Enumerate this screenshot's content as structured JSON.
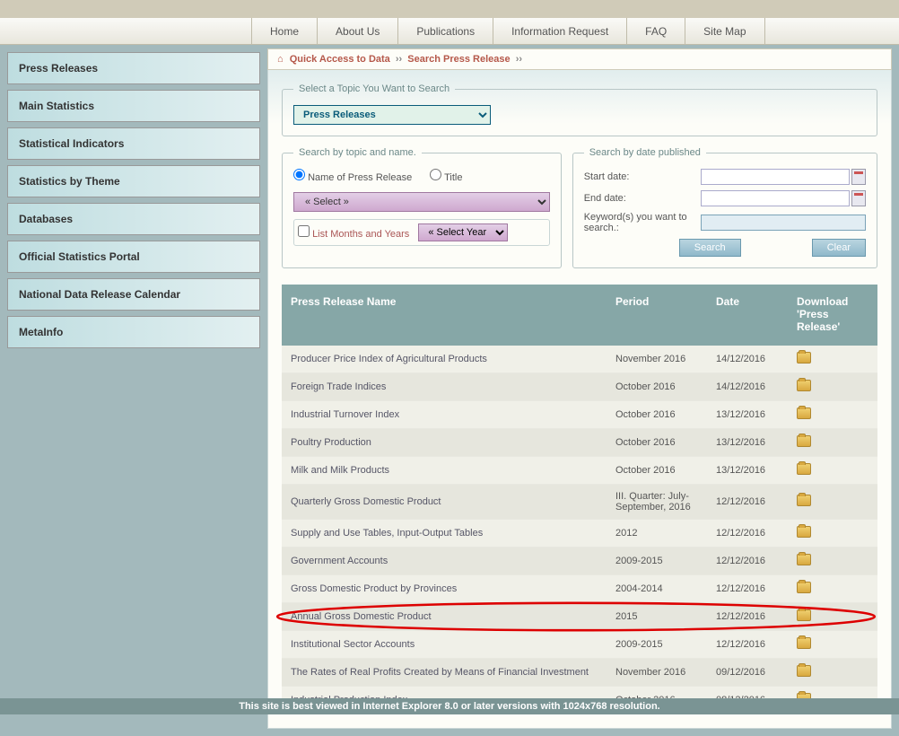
{
  "nav": {
    "items": [
      "Home",
      "About Us",
      "Publications",
      "Information Request",
      "FAQ",
      "Site Map"
    ]
  },
  "sidebar": {
    "items": [
      "Press Releases",
      "Main Statistics",
      "Statistical Indicators",
      "Statistics by Theme",
      "Databases",
      "Official Statistics Portal",
      "National Data Release Calendar",
      "MetaInfo"
    ]
  },
  "breadcrumb": {
    "item1": "Quick Access to Data",
    "item2": "Search Press Release",
    "sep": "››"
  },
  "topic_legend": "Select a Topic You Want to Search",
  "topic_value": "Press Releases",
  "search_by": {
    "legend": "Search by topic and name.",
    "opt_name": "Name of Press Release",
    "opt_title": "Title",
    "select_label": "« Select »",
    "list_months": "List Months and Years",
    "select_year": "« Select Year"
  },
  "search_date": {
    "legend": "Search by date published",
    "start": "Start date:",
    "end": "End date:",
    "keyword": "Keyword(s) you want to search.:",
    "search_btn": "Search",
    "clear_btn": "Clear"
  },
  "results_header": {
    "name": "Press Release Name",
    "period": "Period",
    "date": "Date",
    "download": "Download 'Press Release'"
  },
  "results": [
    {
      "name": "Producer Price Index of Agricultural Products",
      "period": "November 2016",
      "date": "14/12/2016"
    },
    {
      "name": "Foreign Trade Indices",
      "period": "October 2016",
      "date": "14/12/2016"
    },
    {
      "name": "Industrial Turnover Index",
      "period": "October 2016",
      "date": "13/12/2016"
    },
    {
      "name": "Poultry Production",
      "period": "October 2016",
      "date": "13/12/2016"
    },
    {
      "name": "Milk and Milk Products",
      "period": "October 2016",
      "date": "13/12/2016"
    },
    {
      "name": "Quarterly Gross Domestic Product",
      "period": "III. Quarter: July-September, 2016",
      "date": "12/12/2016"
    },
    {
      "name": "Supply and Use Tables, Input-Output Tables",
      "period": "2012",
      "date": "12/12/2016"
    },
    {
      "name": "Government Accounts",
      "period": "2009-2015",
      "date": "12/12/2016"
    },
    {
      "name": "Gross Domestic Product by Provinces",
      "period": "2004-2014",
      "date": "12/12/2016"
    },
    {
      "name": "Annual Gross Domestic Product",
      "period": "2015",
      "date": "12/12/2016",
      "highlighted": true
    },
    {
      "name": "Institutional Sector Accounts",
      "period": "2009-2015",
      "date": "12/12/2016"
    },
    {
      "name": "The Rates of Real Profits Created by Means of Financial Investment",
      "period": "November 2016",
      "date": "09/12/2016"
    },
    {
      "name": "Industrial Production Index",
      "period": "October 2016",
      "date": "08/12/2016"
    }
  ],
  "footer": "This site is best viewed in Internet Explorer 8.0 or later versions with 1024x768 resolution."
}
